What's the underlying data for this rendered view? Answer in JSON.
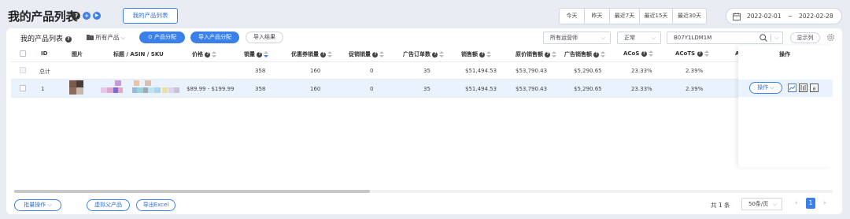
{
  "header": {
    "title": "我的产品列表",
    "tab_button": "我的产品列表"
  },
  "date_range": {
    "quick": [
      "今天",
      "昨天",
      "最近7天",
      "最近15天",
      "最近30天"
    ],
    "start": "2022-02-01",
    "separator": "~",
    "end": "2022-02-28"
  },
  "toolbar": {
    "panel_title": "我的产品列表",
    "folder_label": "所有产品",
    "distribute_label": "产品分配",
    "import_distribute_label": "导入产品分配",
    "import_result_label": "导入结果",
    "operator_select": "所有运营师",
    "status_select": "正常",
    "search_value": "B07Y1LDM1M",
    "display_columns_label": "显示列"
  },
  "table": {
    "columns": [
      "ID",
      "图片",
      "标题 / ASIN / SKU",
      "价格",
      "销量",
      "优惠券销量",
      "促销销量",
      "广告订单数",
      "销售额",
      "原价销售额",
      "广告销售额",
      "ACoS",
      "ACoTS",
      "A",
      "操作"
    ],
    "total_row": {
      "label": "总计",
      "sales_qty": "358",
      "coupon_qty": "160",
      "promo_qty": "0",
      "ad_orders": "35",
      "sales": "$51,494.53",
      "orig_sales": "$53,790.43",
      "ad_sales": "$5,290.65",
      "acos": "23.33%",
      "acots": "2.39%"
    },
    "rows": [
      {
        "id": "1",
        "price": "$89.99 - $199.99",
        "sales_qty": "358",
        "coupon_qty": "160",
        "promo_qty": "0",
        "ad_orders": "35",
        "sales": "$51,494.53",
        "orig_sales": "$53,790.43",
        "ad_sales": "$5,290.65",
        "acos": "23.33%",
        "acots": "2.39%",
        "action_label": "操作"
      }
    ]
  },
  "footer": {
    "batch_label": "批量操作",
    "virtual_parent_label": "虚拟父产品",
    "export_label": "导出Excel",
    "total_text": "共 1 条",
    "page_size": "50条/页",
    "current_page": "1"
  },
  "colors": {
    "accent": "#3b80e8",
    "row_highlight": "#eaf2fd",
    "background": "#e9edf3"
  }
}
